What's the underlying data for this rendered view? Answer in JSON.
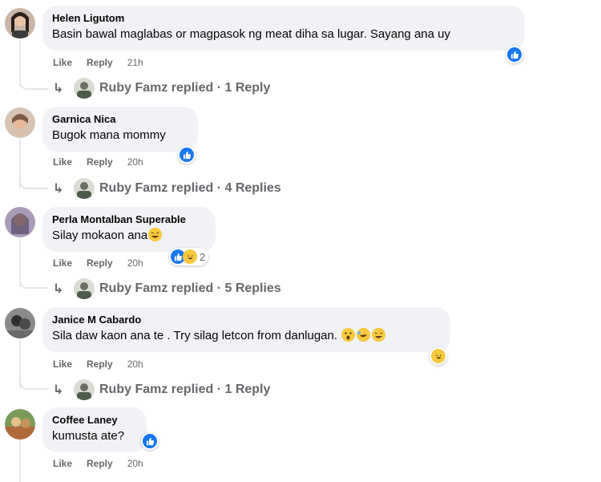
{
  "comments": [
    {
      "author": "Helen Ligutom",
      "text": "Basin bawal maglabas or magpasok ng meat diha sa lugar. Sayang ana uy",
      "like_label": "Like",
      "reply_label": "Reply",
      "time": "21h",
      "reaction": "like",
      "replies_text": "Ruby Famz replied · 1 Reply"
    },
    {
      "author": "Garnica Nica",
      "text": "Bugok mana mommy",
      "like_label": "Like",
      "reply_label": "Reply",
      "time": "20h",
      "reaction": "like",
      "replies_text": "Ruby Famz replied · 4 Replies"
    },
    {
      "author": "Perla Montalban Superable",
      "text": "Silay mokaon ana",
      "like_label": "Like",
      "reply_label": "Reply",
      "time": "20h",
      "reaction_count": "2",
      "replies_text": "Ruby Famz replied · 5 Replies"
    },
    {
      "author": "Janice M Cabardo",
      "text": "Sila daw kaon ana te . Try silag letcon from danlugan.",
      "like_label": "Like",
      "reply_label": "Reply",
      "time": "20h",
      "reaction": "haha",
      "replies_text": "Ruby Famz replied · 1 Reply"
    },
    {
      "author": "Coffee Laney",
      "text": "kumusta ate?",
      "like_label": "Like",
      "reply_label": "Reply",
      "time": "20h",
      "reaction": "like"
    }
  ],
  "colors": {
    "bubble": "#f0f2f5",
    "meta": "#65676b",
    "like_blue": "#1877f2",
    "emoji_yellow": "#f7c93e"
  }
}
